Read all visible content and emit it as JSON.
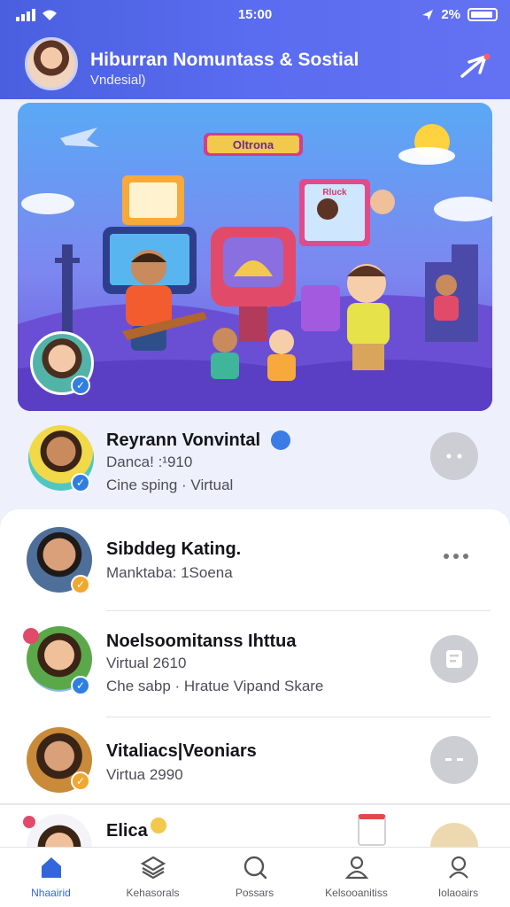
{
  "status_bar": {
    "time": "15:00",
    "battery": "2%"
  },
  "header": {
    "title": "Hiburran Nomuntass & Sostial",
    "subtitle": "Vndesial)"
  },
  "banner": {
    "sign": "Oltrona",
    "poster": "Rluck"
  },
  "featured": {
    "name": "Reyrann Vonvintal",
    "line1": "Danca! :¹910",
    "line2": "Cine sping · Virtual"
  },
  "list": [
    {
      "name": "Sibddeg Kating.",
      "line1": "Manktaba: 1Soena",
      "line2": ""
    },
    {
      "name": "Noelsoomitanss Ihttua",
      "line1": "Virtual 2610",
      "line2": "Che sabp · Hratue Vipand Skare"
    },
    {
      "name": "Vitaliacs|Veoniars",
      "line1": "Virtua 2990",
      "line2": ""
    },
    {
      "name": "Elica",
      "line1": "",
      "line2": ""
    }
  ],
  "tabs": [
    {
      "label": "Nhaairid"
    },
    {
      "label": "Kehasorals"
    },
    {
      "label": "Possars"
    },
    {
      "label": "Kelsooanitiss"
    },
    {
      "label": "Iolaoairs"
    }
  ],
  "colors": {
    "header": "#4a5fe0",
    "accent_blue": "#3366dd",
    "badge_orange": "#f0a830",
    "badge_blue": "#2f7fe0"
  }
}
